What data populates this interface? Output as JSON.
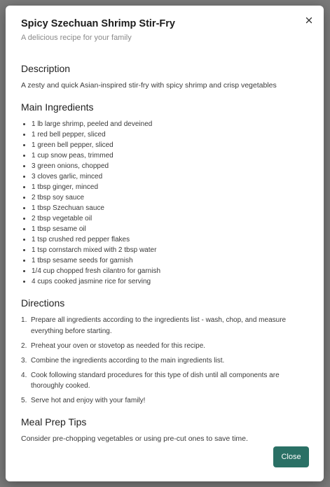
{
  "modal": {
    "title": "Spicy Szechuan Shrimp Stir-Fry",
    "subtitle": "A delicious recipe for your family",
    "close_icon": "close-icon",
    "close_button_label": "Close",
    "accent_color": "#2a7065"
  },
  "description": {
    "heading": "Description",
    "text": "A zesty and quick Asian-inspired stir-fry with spicy shrimp and crisp vegetables"
  },
  "ingredients": {
    "heading": "Main Ingredients",
    "items": [
      "1 lb large shrimp, peeled and deveined",
      "1 red bell pepper, sliced",
      "1 green bell pepper, sliced",
      "1 cup snow peas, trimmed",
      "3 green onions, chopped",
      "3 cloves garlic, minced",
      "1 tbsp ginger, minced",
      "2 tbsp soy sauce",
      "1 tbsp Szechuan sauce",
      "2 tbsp vegetable oil",
      "1 tbsp sesame oil",
      "1 tsp crushed red pepper flakes",
      "1 tsp cornstarch mixed with 2 tbsp water",
      "1 tbsp sesame seeds for garnish",
      "1/4 cup chopped fresh cilantro for garnish",
      "4 cups cooked jasmine rice for serving"
    ]
  },
  "directions": {
    "heading": "Directions",
    "steps": [
      "Prepare all ingredients according to the ingredients list - wash, chop, and measure everything before starting.",
      "Preheat your oven or stovetop as needed for this recipe.",
      "Combine the ingredients according to the main ingredients list.",
      "Cook following standard procedures for this type of dish until all components are thoroughly cooked.",
      "Serve hot and enjoy with your family!"
    ]
  },
  "tips": {
    "heading": "Meal Prep Tips",
    "text": "Consider pre-chopping vegetables or using pre-cut ones to save time."
  }
}
